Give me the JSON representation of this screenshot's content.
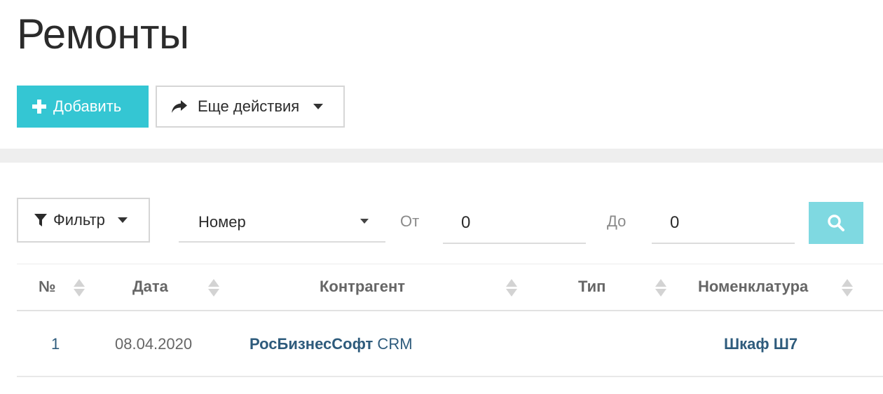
{
  "page": {
    "title": "Ремонты"
  },
  "toolbar": {
    "add_label": "Добавить",
    "more_label": "Еще действия"
  },
  "filter": {
    "button_label": "Фильтр",
    "field_select": "Номер",
    "from_label": "От",
    "from_value": "0",
    "to_label": "До",
    "to_value": "0"
  },
  "table": {
    "columns": [
      "№",
      "Дата",
      "Контрагент",
      "Тип",
      "Номенклатура"
    ],
    "rows": [
      {
        "number": "1",
        "date": "08.04.2020",
        "counterparty_bold": "РосБизнесСофт",
        "counterparty_rest": " CRM",
        "type": "",
        "nomenclature": "Шкаф Ш7"
      }
    ]
  },
  "colors": {
    "primary": "#34c6d3",
    "search_button": "#7fd9e1",
    "link": "#2e5b7c"
  },
  "icons": [
    "plus-icon",
    "share-arrow-icon",
    "chevron-down-icon",
    "filter-icon",
    "search-icon",
    "sort-icon"
  ]
}
